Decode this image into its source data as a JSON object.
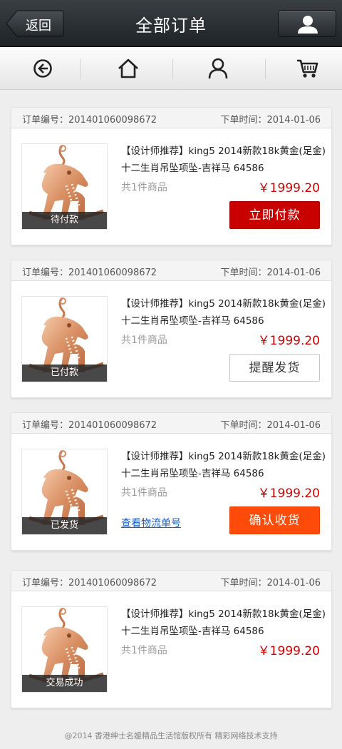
{
  "header": {
    "back_label": "返回",
    "title": "全部订单",
    "user_icon": "user-icon"
  },
  "nav": {
    "items": [
      {
        "icon": "back-circle-icon"
      },
      {
        "icon": "home-icon"
      },
      {
        "icon": "user-icon"
      },
      {
        "icon": "cart-icon"
      }
    ]
  },
  "orders": [
    {
      "order_no": "订单编号：201401060098672",
      "order_time": "下单时间：2014-01-06",
      "product_line1": "【设计师推荐】king5  2014新款18k黄金(足金)",
      "product_line2": "十二生肖吊坠项坠-吉祥马 64586",
      "count": "共1件商品",
      "price": "￥1999.20",
      "status": "待付款",
      "action": "立即付款"
    },
    {
      "order_no": "订单编号：201401060098672",
      "order_time": "下单时间：2014-01-06",
      "product_line1": "【设计师推荐】king5  2014新款18k黄金(足金)",
      "product_line2": "十二生肖吊坠项坠-吉祥马 64586",
      "count": "共1件商品",
      "price": "￥1999.20",
      "status": "已付款",
      "action": "提醒发货"
    },
    {
      "order_no": "订单编号：201401060098672",
      "order_time": "下单时间：2014-01-06",
      "product_line1": "【设计师推荐】king5  2014新款18k黄金(足金)",
      "product_line2": "十二生肖吊坠项坠-吉祥马 64586",
      "count": "共1件商品",
      "price": "￥1999.20",
      "status": "已发货",
      "link": "查看物流单号",
      "action": "确认收货"
    },
    {
      "order_no": "订单编号：201401060098672",
      "order_time": "下单时间：2014-01-06",
      "product_line1": "【设计师推荐】king5  2014新款18k黄金(足金)",
      "product_line2": "十二生肖吊坠项坠-吉祥马 64586",
      "count": "共1件商品",
      "price": "￥1999.20",
      "status": "交易成功"
    }
  ],
  "footer": {
    "text": "@2014  香港绅士名媛精品生活馆版权所有     精彩网络技术支持"
  },
  "colors": {
    "price": "#d60000",
    "pay_button": "#c80000",
    "confirm_button": "#ff4b0a",
    "link": "#1a5fc4"
  }
}
